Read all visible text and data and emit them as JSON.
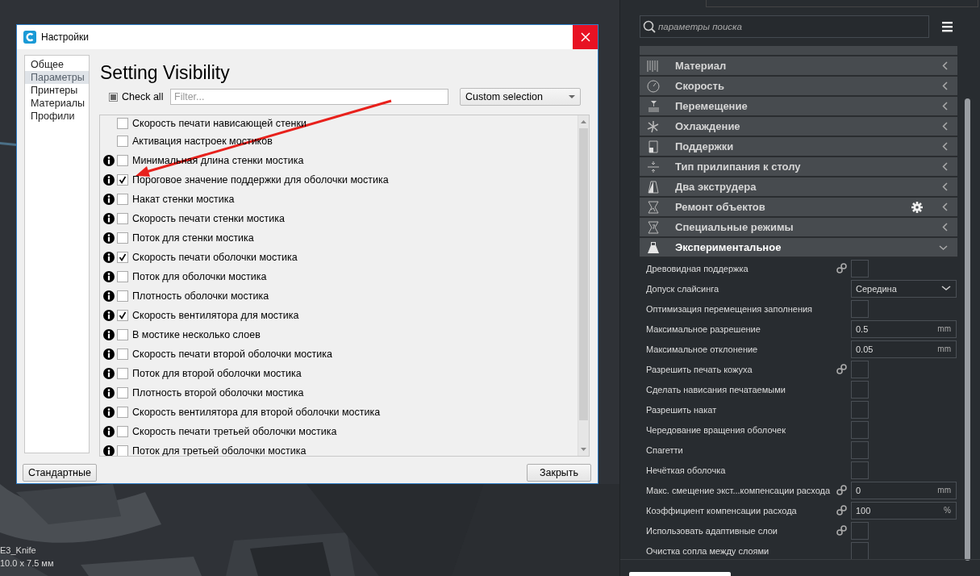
{
  "dialog": {
    "title": "Настройки",
    "sidebar": [
      {
        "label": "Общее",
        "selected": false
      },
      {
        "label": "Параметры",
        "selected": true
      },
      {
        "label": "Принтеры",
        "selected": false
      },
      {
        "label": "Материалы",
        "selected": false
      },
      {
        "label": "Профили",
        "selected": false
      }
    ],
    "heading": "Setting Visibility",
    "check_all": {
      "label": "Check all",
      "partial": true
    },
    "filter": {
      "placeholder": "Filter..."
    },
    "preset": {
      "value": "Custom selection"
    },
    "settings": [
      {
        "label": "Скорость печати нависающей стенки",
        "info": false,
        "checked": false
      },
      {
        "label": "Активация настроек мостиков",
        "info": false,
        "checked": false
      },
      {
        "label": "Минимальная длина стенки мостика",
        "info": true,
        "checked": false
      },
      {
        "label": "Пороговое значение поддержки для оболочки мостика",
        "info": true,
        "checked": true
      },
      {
        "label": "Накат стенки мостика",
        "info": true,
        "checked": false
      },
      {
        "label": "Скорость печати стенки мостика",
        "info": true,
        "checked": false
      },
      {
        "label": "Поток для стенки мостика",
        "info": true,
        "checked": false
      },
      {
        "label": "Скорость печати оболочки мостика",
        "info": true,
        "checked": true
      },
      {
        "label": "Поток для оболочки мостика",
        "info": true,
        "checked": false
      },
      {
        "label": "Плотность оболочки мостика",
        "info": true,
        "checked": false
      },
      {
        "label": "Скорость вентилятора для мостика",
        "info": true,
        "checked": true
      },
      {
        "label": "В мостике несколько слоев",
        "info": true,
        "checked": false
      },
      {
        "label": "Скорость печати второй оболочки мостика",
        "info": true,
        "checked": false
      },
      {
        "label": "Поток для второй оболочки мостика",
        "info": true,
        "checked": false
      },
      {
        "label": "Плотность второй оболочки мостика",
        "info": true,
        "checked": false
      },
      {
        "label": "Скорость вентилятора для второй оболочки мостика",
        "info": true,
        "checked": false
      },
      {
        "label": "Скорость печати третьей оболочки мостика",
        "info": true,
        "checked": false
      },
      {
        "label": "Поток для третьей оболочки мостика",
        "info": true,
        "checked": false
      }
    ],
    "buttons": [
      "Стандартные",
      "Закрыть"
    ]
  },
  "viewport": {
    "object_name": "E3_Knife",
    "dimensions": "10.0 x 7.5 мм"
  },
  "panel": {
    "search": {
      "placeholder": "параметры поиска"
    },
    "categories": [
      {
        "label": "Материал",
        "expanded": false,
        "gear": false
      },
      {
        "label": "Скорость",
        "expanded": false,
        "gear": false
      },
      {
        "label": "Перемещение",
        "expanded": false,
        "gear": false
      },
      {
        "label": "Охлаждение",
        "expanded": false,
        "gear": false
      },
      {
        "label": "Поддержки",
        "expanded": false,
        "gear": false
      },
      {
        "label": "Тип прилипания к столу",
        "expanded": false,
        "gear": false
      },
      {
        "label": "Два экструдера",
        "expanded": false,
        "gear": false
      },
      {
        "label": "Ремонт объектов",
        "expanded": false,
        "gear": true
      },
      {
        "label": "Специальные режимы",
        "expanded": false,
        "gear": false
      },
      {
        "label": "Экспериментальное",
        "expanded": true,
        "gear": false
      }
    ],
    "settings": [
      {
        "label": "Древовидная поддержка",
        "linked": true,
        "kind": "checkbox",
        "checked": false
      },
      {
        "label": "Допуск слайсинга",
        "linked": false,
        "kind": "select",
        "value": "Середина"
      },
      {
        "label": "Оптимизация перемещения заполнения",
        "linked": false,
        "kind": "checkbox",
        "checked": false
      },
      {
        "label": "Максимальное разрешение",
        "linked": false,
        "kind": "number",
        "value": "0.5",
        "unit": "mm"
      },
      {
        "label": "Максимальное отклонение",
        "linked": false,
        "kind": "number",
        "value": "0.05",
        "unit": "mm"
      },
      {
        "label": "Разрешить печать кожуха",
        "linked": true,
        "kind": "checkbox",
        "checked": false
      },
      {
        "label": "Сделать нависания печатаемыми",
        "linked": false,
        "kind": "checkbox",
        "checked": false
      },
      {
        "label": "Разрешить накат",
        "linked": false,
        "kind": "checkbox",
        "checked": false
      },
      {
        "label": "Чередование вращения оболочек",
        "linked": false,
        "kind": "checkbox",
        "checked": false
      },
      {
        "label": "Спагетти",
        "linked": false,
        "kind": "checkbox",
        "checked": false
      },
      {
        "label": "Нечёткая оболочка",
        "linked": false,
        "kind": "checkbox",
        "checked": false
      },
      {
        "label": "Макс. смещение экст...компенсации расхода",
        "linked": true,
        "kind": "number",
        "value": "0",
        "unit": "mm"
      },
      {
        "label": "Коэффициент компенсации расхода",
        "linked": true,
        "kind": "number",
        "value": "100",
        "unit": "%"
      },
      {
        "label": "Использовать адаптивные слои",
        "linked": true,
        "kind": "checkbox",
        "checked": false
      },
      {
        "label": "Очистка сопла между слоями",
        "linked": false,
        "kind": "checkbox",
        "checked": false
      }
    ]
  }
}
